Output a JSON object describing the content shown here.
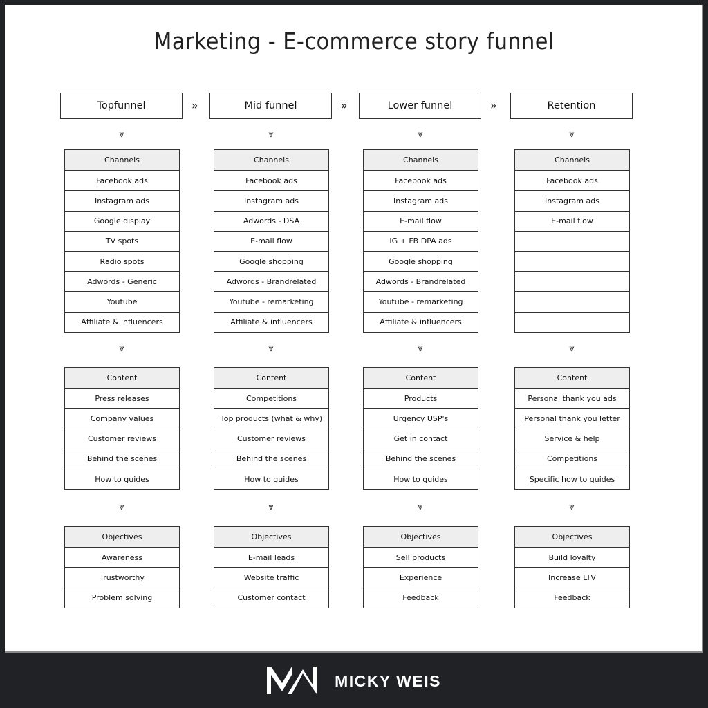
{
  "title": "Marketing - E-commerce story funnel",
  "stages": [
    {
      "label": "Topfunnel",
      "channels": [
        "Facebook ads",
        "Instagram ads",
        "Google display",
        "TV spots",
        "Radio spots",
        "Adwords - Generic",
        "Youtube",
        "Affiliate & influencers"
      ],
      "content": [
        "Press releases",
        "Company values",
        "Customer reviews",
        "Behind the scenes",
        "How to guides"
      ],
      "objectives": [
        "Awareness",
        "Trustworthy",
        "Problem solving"
      ]
    },
    {
      "label": "Mid funnel",
      "channels": [
        "Facebook ads",
        "Instagram ads",
        "Adwords - DSA",
        "E-mail flow",
        "Google shopping",
        "Adwords - Brandrelated",
        "Youtube - remarketing",
        "Affiliate & influencers"
      ],
      "content": [
        "Competitions",
        "Top products (what & why)",
        "Customer reviews",
        "Behind the scenes",
        "How to guides"
      ],
      "objectives": [
        "E-mail leads",
        "Website traffic",
        "Customer contact"
      ]
    },
    {
      "label": "Lower funnel",
      "channels": [
        "Facebook ads",
        "Instagram ads",
        "E-mail flow",
        "IG + FB DPA ads",
        "Google shopping",
        "Adwords - Brandrelated",
        "Youtube - remarketing",
        "Affiliate & influencers"
      ],
      "content": [
        "Products",
        "Urgency USP's",
        "Get in contact",
        "Behind the scenes",
        "How to guides"
      ],
      "objectives": [
        "Sell products",
        "Experience",
        "Feedback"
      ]
    },
    {
      "label": "Retention",
      "channels": [
        "Facebook ads",
        "Instagram ads",
        "E-mail flow",
        "",
        "",
        "",
        "",
        ""
      ],
      "content": [
        "Personal thank you ads",
        "Personal thank you letter",
        "Service & help",
        "Competitions",
        "Specific how to guides"
      ],
      "objectives": [
        "Build loyalty",
        "Increase LTV",
        "Feedback"
      ]
    }
  ],
  "section_headers": {
    "channels": "Channels",
    "content": "Content",
    "objectives": "Objectives"
  },
  "arrows": {
    "right": "»",
    "down": "⩔"
  },
  "footer": {
    "brand": "MICKY WEIS",
    "logo_icon": "mw-logo-icon"
  },
  "colors": {
    "background": "#212226",
    "canvas": "#ffffff",
    "header_fill": "#eeeeee",
    "border": "#333333"
  }
}
